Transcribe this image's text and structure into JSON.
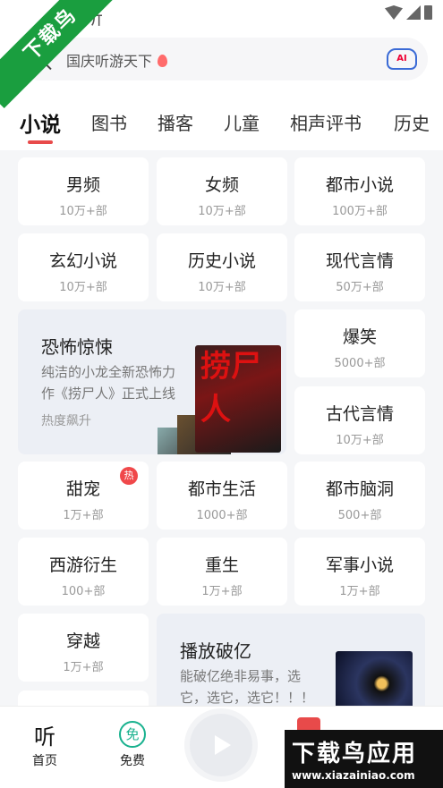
{
  "status_bar": {
    "app_label": "听"
  },
  "watermark_ribbon": "下载鸟",
  "search": {
    "placeholder": "国庆听游天下",
    "ai_label": "AI"
  },
  "tabs": [
    {
      "label": "小说"
    },
    {
      "label": "图书"
    },
    {
      "label": "播客"
    },
    {
      "label": "儿童"
    },
    {
      "label": "相声评书"
    },
    {
      "label": "历史"
    }
  ],
  "categories": [
    {
      "name": "男频",
      "count": "10万+部"
    },
    {
      "name": "女频",
      "count": "10万+部"
    },
    {
      "name": "都市小说",
      "count": "100万+部"
    },
    {
      "name": "玄幻小说",
      "count": "10万+部"
    },
    {
      "name": "历史小说",
      "count": "10万+部"
    },
    {
      "name": "现代言情",
      "count": "50万+部"
    },
    {
      "name": "爆笑",
      "count": "5000+部"
    },
    {
      "name": "古代言情",
      "count": "10万+部"
    },
    {
      "name": "甜宠",
      "count": "1万+部",
      "badge": "热"
    },
    {
      "name": "都市生活",
      "count": "1000+部"
    },
    {
      "name": "都市脑洞",
      "count": "500+部"
    },
    {
      "name": "西游衍生",
      "count": "100+部"
    },
    {
      "name": "重生",
      "count": "1万+部"
    },
    {
      "name": "军事小说",
      "count": "1万+部"
    },
    {
      "name": "穿越",
      "count": "1万+部"
    }
  ],
  "features": [
    {
      "title": "恐怖惊悚",
      "desc": "纯洁的小龙全新恐怖力作《捞尸人》正式上线",
      "tag": "热度飙升",
      "cover_text": "捞尸人"
    },
    {
      "title": "播放破亿",
      "desc": "能破亿绝非易事，选它，选它，选它！！！"
    }
  ],
  "bottom_nav": [
    {
      "label": "首页",
      "icon": "listen-icon"
    },
    {
      "label": "免费",
      "icon": "free-icon",
      "glyph": "免"
    }
  ],
  "watermark": {
    "title": "下载鸟应用",
    "url": "www.xiazainiao.com"
  },
  "colors": {
    "accent": "#e84a4a",
    "free_green": "#18b18e",
    "ribbon_green": "#1a9e3f"
  }
}
